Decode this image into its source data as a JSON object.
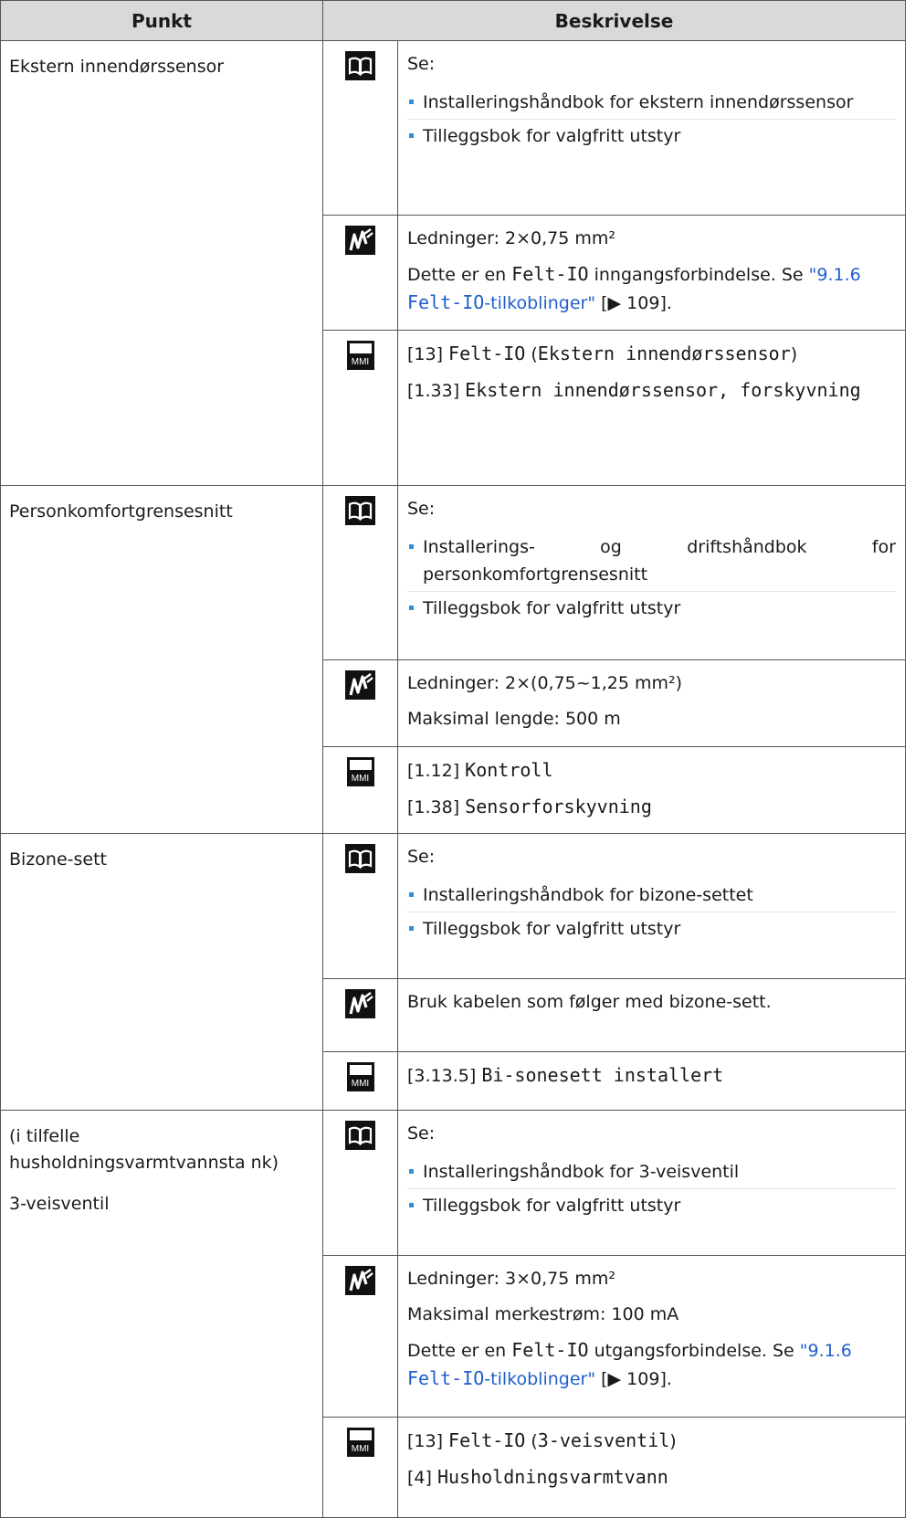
{
  "header": {
    "col_item": "Punkt",
    "col_desc": "Beskrivelse"
  },
  "icons": {
    "book": "book-icon",
    "wire": "wiring-icon",
    "mmi": "mmi-icon",
    "mmi_text": "MMI"
  },
  "rows": [
    {
      "item": [
        "Ekstern innendørssensor"
      ],
      "book": {
        "see": "Se:",
        "bullets": [
          "Installeringshåndbok for ekstern innendørssensor",
          "Tilleggsbok for valgfritt utstyr"
        ]
      },
      "wire": {
        "line1": "Ledninger: 2×0,75 mm²",
        "fio_pre": "Dette er en ",
        "fio_code": "Felt-IO",
        "fio_post": " inngangsforbindelse. Se ",
        "link_pre": "\"9.1.6 ",
        "link_code": "Felt-IO",
        "link_post": "-tilkoblinger\"",
        "page_ref": " [▶ 109]."
      },
      "mmi": [
        {
          "ref": "[13] ",
          "code": "Felt-IO",
          "sep": " (",
          "code2": "Ekstern innendørssensor",
          "end": ")"
        },
        {
          "ref": "[1.33] ",
          "code": "Ekstern innendørssensor, forskyvning"
        }
      ]
    },
    {
      "item": [
        "Personkomfortgrensesnitt"
      ],
      "book": {
        "see": "Se:",
        "bullets": [
          "Installerings- og driftshåndbok for personkomfortgrensesnitt",
          "Tilleggsbok for valgfritt utstyr"
        ]
      },
      "wire": {
        "line1": "Ledninger: 2×(0,75~1,25 mm²)",
        "line2": "Maksimal lengde: 500 m"
      },
      "mmi": [
        {
          "ref": "[1.12] ",
          "code": "Kontroll"
        },
        {
          "ref": "[1.38] ",
          "code": "Sensorforskyvning"
        }
      ]
    },
    {
      "item": [
        "Bizone-sett"
      ],
      "book": {
        "see": "Se:",
        "bullets": [
          "Installeringshåndbok for bizone-settet",
          "Tilleggsbok for valgfritt utstyr"
        ]
      },
      "wire": {
        "line1": "Bruk kabelen som følger med bizone-sett."
      },
      "mmi": [
        {
          "ref": "[3.13.5] ",
          "code": "Bi-sonesett installert"
        }
      ]
    },
    {
      "item": [
        "(i tilfelle husholdningsvarmtvannsta nk)",
        "3-veisventil"
      ],
      "book": {
        "see": "Se:",
        "bullets": [
          "Installeringshåndbok for 3-veisventil",
          "Tilleggsbok for valgfritt utstyr"
        ]
      },
      "wire": {
        "line1": "Ledninger: 3×0,75 mm²",
        "line2": "Maksimal merkestrøm: 100 mA",
        "fio_pre": "Dette er en ",
        "fio_code": "Felt-IO",
        "fio_post": " utgangsforbindelse. Se ",
        "link_pre": "\"9.1.6 ",
        "link_code": "Felt-IO",
        "link_post": "-tilkoblinger\"",
        "page_ref": " [▶ 109]."
      },
      "mmi": [
        {
          "ref": "[13] ",
          "code": "Felt-IO",
          "sep": " (",
          "code2": "3-veisventil",
          "end": ")"
        },
        {
          "ref": "[4] ",
          "code": "Husholdningsvarmtvann"
        }
      ]
    }
  ]
}
